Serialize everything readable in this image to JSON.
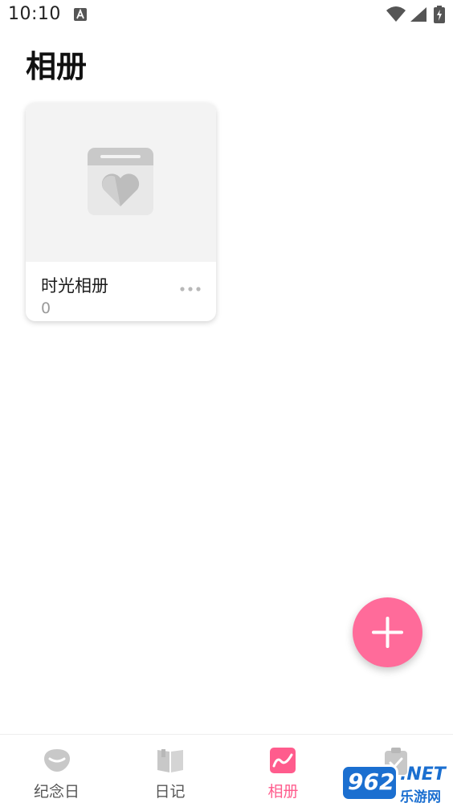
{
  "status_bar": {
    "time": "10:10"
  },
  "header": {
    "title": "相册"
  },
  "albums": [
    {
      "name": "时光相册",
      "count": "0"
    }
  ],
  "bottom_nav": {
    "items": [
      {
        "label": "纪念日",
        "icon": "anniversary-icon",
        "active": false
      },
      {
        "label": "日记",
        "icon": "diary-book-icon",
        "active": false
      },
      {
        "label": "相册",
        "icon": "album-icon",
        "active": true
      },
      {
        "label": "",
        "icon": "checklist-icon",
        "active": false
      }
    ]
  },
  "colors": {
    "accent": "#ff6b9a",
    "active_nav": "#ff5c8d",
    "icon_gray": "#c8c8c8"
  },
  "watermark": {
    "digits": "962",
    "suffix": ".NET",
    "text": "乐游网"
  }
}
